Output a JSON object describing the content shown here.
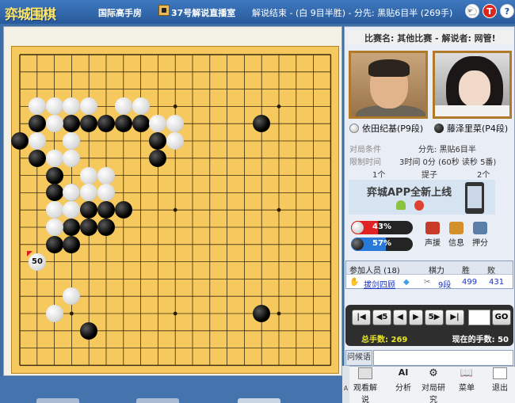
{
  "titlebar": {
    "logo": "弈城围棋",
    "room": "国际高手房",
    "broadcast_room": "37号解说直播室",
    "status": "解说结束 - (白 9目半胜) - 分先: 黑贴6目半 (269手)",
    "sheep_icon": "sheep-mascot-icon",
    "t_icon": "T",
    "help_icon": "?"
  },
  "game": {
    "event_line": "比赛名: 其他比赛 - 解说者: 网管!",
    "white_player": "依田纪基(P9段)",
    "black_player": "藤泽里菜(P4段)",
    "conditions_label": "对局条件",
    "conditions_value": "分先: 黑贴6目半",
    "time_label": "限制时间",
    "time_value": "3时间 0分 (60秒 读秒 5番)",
    "captured_label": "提子",
    "white_captured": "1个",
    "black_captured": "2个",
    "ad_text": "弈城APP全新上线",
    "white_win_pct": "43%",
    "black_win_pct": "57%",
    "white_win_value": 43,
    "black_win_value": 57,
    "last_move_label": "50"
  },
  "actions": [
    {
      "label": "声援",
      "color": "#c83a2a"
    },
    {
      "label": "信息",
      "color": "#d4902a"
    },
    {
      "label": "押分",
      "color": "#5a7ea8"
    }
  ],
  "participants": {
    "header": "参加人员 (18)",
    "col_rank": "棋力",
    "col_win": "胜",
    "col_loss": "败",
    "rows": [
      {
        "name": "拔剑四顾",
        "rank": "9段",
        "wins": "499",
        "losses": "431"
      }
    ]
  },
  "navigation": {
    "first": "|◀",
    "back5": "◀5",
    "back1": "◀",
    "fwd1": "▶",
    "fwd5": "5▶",
    "last": "▶|",
    "go": "GO",
    "move_input": ""
  },
  "counts": {
    "total_label": "总手数: 269",
    "current_label": "现在的手数: 50"
  },
  "chat": {
    "label": "问候语",
    "input": ""
  },
  "bottom_toolbar": [
    {
      "label": "观看解说"
    },
    {
      "label": "分析"
    },
    {
      "label": "对局研究"
    },
    {
      "label": "菜单"
    },
    {
      "label": "退出"
    }
  ],
  "board": {
    "size": 19,
    "black_stones": [
      [
        1,
        4
      ],
      [
        3,
        4
      ],
      [
        4,
        4
      ],
      [
        5,
        4
      ],
      [
        6,
        4
      ],
      [
        7,
        4
      ],
      [
        0,
        5
      ],
      [
        8,
        5
      ],
      [
        1,
        6
      ],
      [
        8,
        6
      ],
      [
        2,
        7
      ],
      [
        2,
        8
      ],
      [
        3,
        8
      ],
      [
        4,
        9
      ],
      [
        5,
        9
      ],
      [
        6,
        9
      ],
      [
        3,
        10
      ],
      [
        4,
        10
      ],
      [
        5,
        10
      ],
      [
        2,
        11
      ],
      [
        3,
        11
      ],
      [
        14,
        4
      ],
      [
        14,
        15
      ],
      [
        4,
        16
      ]
    ],
    "white_stones": [
      [
        1,
        3
      ],
      [
        2,
        3
      ],
      [
        3,
        3
      ],
      [
        4,
        3
      ],
      [
        6,
        3
      ],
      [
        7,
        3
      ],
      [
        2,
        4
      ],
      [
        8,
        4
      ],
      [
        9,
        4
      ],
      [
        1,
        5
      ],
      [
        3,
        5
      ],
      [
        9,
        5
      ],
      [
        2,
        6
      ],
      [
        3,
        6
      ],
      [
        4,
        7
      ],
      [
        5,
        7
      ],
      [
        3,
        8
      ],
      [
        4,
        8
      ],
      [
        2,
        9
      ],
      [
        3,
        9
      ],
      [
        5,
        8
      ],
      [
        2,
        10
      ],
      [
        3,
        14
      ],
      [
        2,
        15
      ],
      [
        1,
        12
      ]
    ],
    "hoshi": [
      [
        3,
        3
      ],
      [
        9,
        3
      ],
      [
        15,
        3
      ],
      [
        3,
        9
      ],
      [
        9,
        9
      ],
      [
        15,
        9
      ],
      [
        3,
        15
      ],
      [
        9,
        15
      ],
      [
        15,
        15
      ]
    ]
  }
}
